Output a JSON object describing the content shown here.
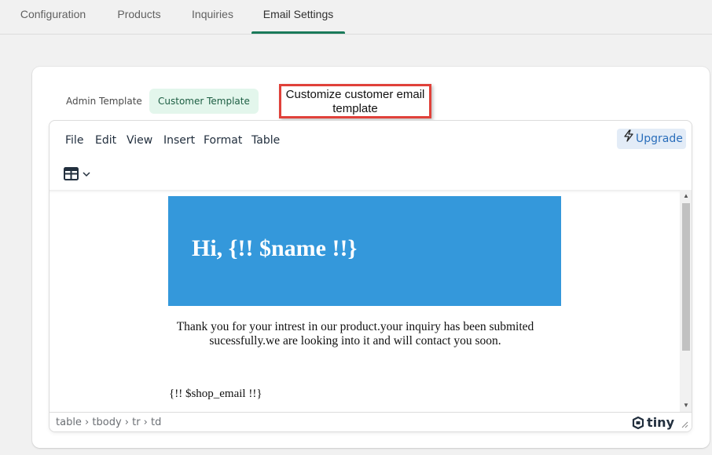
{
  "top_tabs": [
    {
      "label": "Configuration",
      "active": false
    },
    {
      "label": "Products",
      "active": false
    },
    {
      "label": "Inquiries",
      "active": false
    },
    {
      "label": "Email Settings",
      "active": true
    }
  ],
  "template_tabs": [
    {
      "label": "Admin Template",
      "active": false
    },
    {
      "label": "Customer Template",
      "active": true
    }
  ],
  "annotation": {
    "text": "Customize customer email template"
  },
  "editor": {
    "menu": [
      "File",
      "Edit",
      "View",
      "Insert",
      "Format",
      "Table"
    ],
    "upgrade_label": "Upgrade",
    "toolbar_icon": "table-icon",
    "content": {
      "heading": "Hi, {!! $name !!}",
      "body": "Thank you for your intrest in our product.your inquiry has been submited sucessfully.we are looking into it and will contact you soon.",
      "footer": "{!! $shop_email !!}"
    },
    "status_path": "table › tbody › tr › td",
    "brand": "tiny"
  },
  "colors": {
    "accent": "#1a7a5a",
    "hero_bg": "#3498db",
    "active_tab_bg": "#e3f6ec",
    "annotation_border": "#e0413a"
  }
}
